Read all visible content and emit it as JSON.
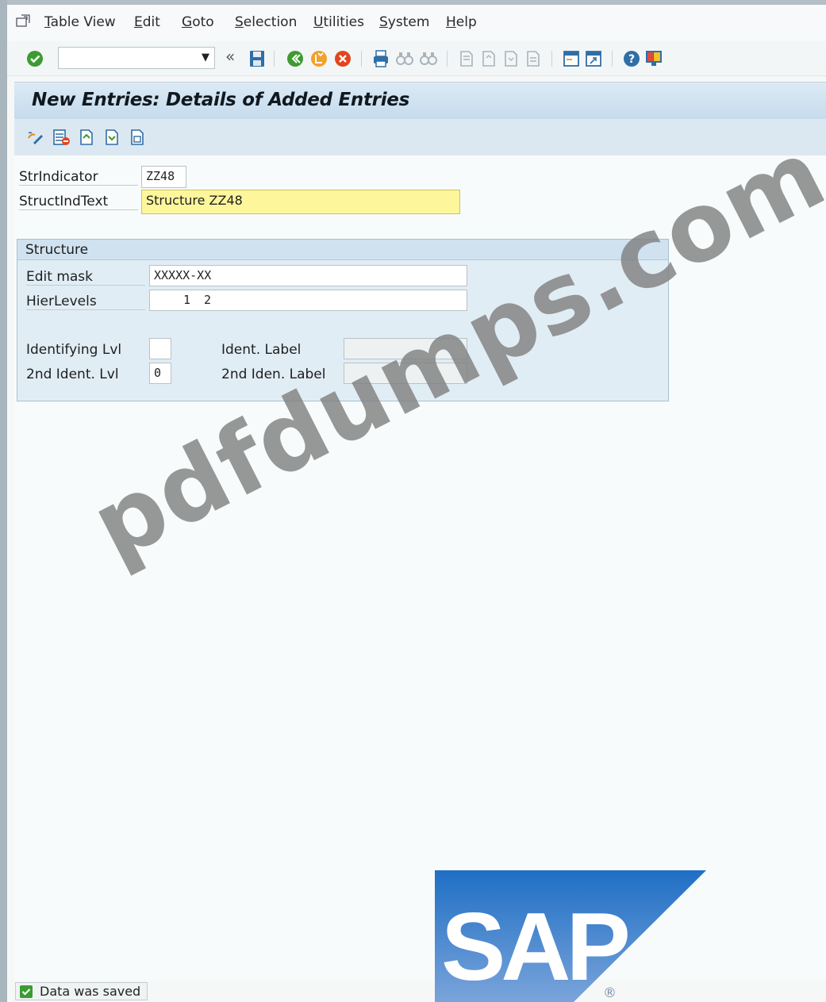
{
  "menubar": {
    "items": [
      "Table View",
      "Edit",
      "Goto",
      "Selection",
      "Utilities",
      "System",
      "Help"
    ]
  },
  "toolbar": {
    "command_value": "",
    "icons": [
      "enter-icon",
      "history-back-icon",
      "save-icon",
      "back-icon",
      "exit-icon",
      "cancel-icon",
      "print-icon",
      "find-icon",
      "find-next-icon",
      "first-page-icon",
      "previous-page-icon",
      "next-page-icon",
      "last-page-icon",
      "create-session-icon",
      "shortcut-icon",
      "help-icon",
      "customize-layout-icon"
    ]
  },
  "screen": {
    "title": "New Entries: Details of Added Entries"
  },
  "app_toolbar": {
    "icons": [
      "change-display-icon",
      "delete-icon",
      "previous-entry-icon",
      "next-entry-icon",
      "select-all-icon"
    ]
  },
  "form": {
    "str_indicator_label": "StrIndicator",
    "str_indicator_value": "ZZ48",
    "struct_ind_text_label": "StructIndText",
    "struct_ind_text_value": "Structure ZZ48"
  },
  "structure": {
    "title": "Structure",
    "edit_mask_label": "Edit mask",
    "edit_mask_value": "XXXXX-XX",
    "hier_levels_label": "HierLevels",
    "hier_levels_value": "1 2",
    "identifying_lvl_label": "Identifying Lvl",
    "identifying_lvl_value": "",
    "second_ident_lvl_label": "2nd Ident. Lvl",
    "second_ident_lvl_value": "0",
    "ident_label_label": "Ident. Label",
    "ident_label_value": "",
    "second_iden_label_label": "2nd Iden. Label",
    "second_iden_label_value": ""
  },
  "watermark": "pdfdumps.com",
  "logo": {
    "text": "SAP",
    "registered": "®"
  },
  "status": {
    "message": "Data was saved"
  },
  "colors": {
    "title_bg": "#c5dbed",
    "required_field": "#fdf69b",
    "sap_blue": "#1f6fc5",
    "ok_green": "#3c9b32"
  }
}
